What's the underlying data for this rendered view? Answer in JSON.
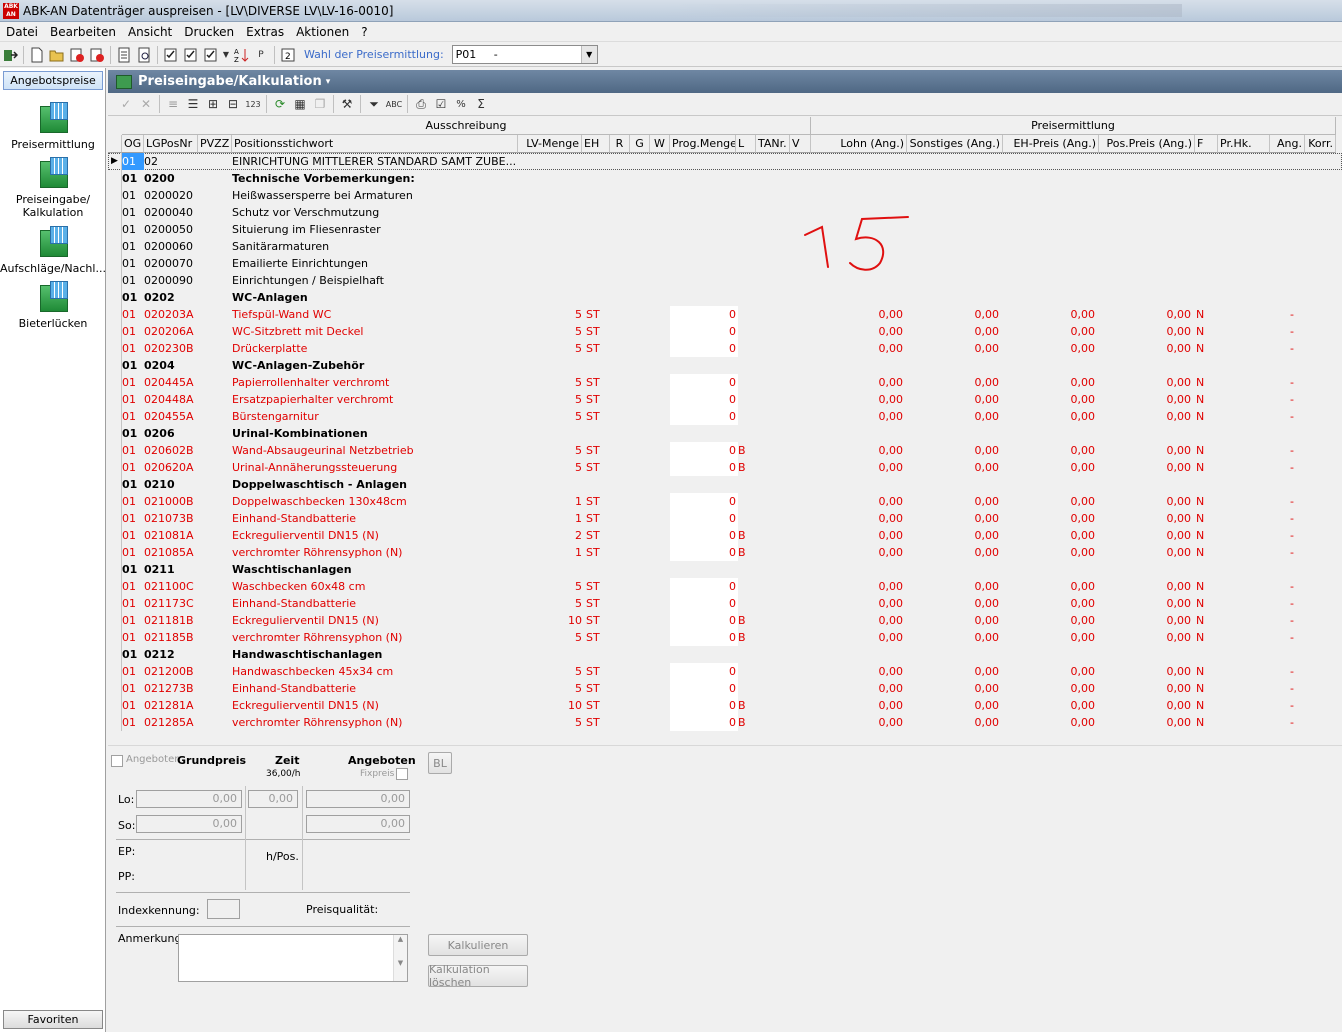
{
  "window": {
    "title": "ABK-AN Datenträger auspreisen - [LV\\DIVERSE LV\\LV-16-0010]",
    "app_icon_text": "ABK AN"
  },
  "menu": [
    "Datei",
    "Bearbeiten",
    "Ansicht",
    "Drucken",
    "Extras",
    "Aktionen",
    "?"
  ],
  "toolbar": {
    "preis_label": "Wahl der Preisermittlung:",
    "preis_value": "P01     -"
  },
  "sidebar": {
    "top_button": "Angebotspreise",
    "items": [
      "Preisermittlung",
      "Preiseingabe/\nKalkulation",
      "Aufschläge/Nachl...",
      "Bieterlücken"
    ],
    "favorites": "Favoriten"
  },
  "panel": {
    "title": "Preiseingabe/Kalkulation"
  },
  "grid": {
    "group_headers": [
      "Ausschreibung",
      "Preisermittlung"
    ],
    "columns": [
      "OG",
      "LGPosNr",
      "PVZZ",
      "Positionsstichwort",
      "LV-Menge",
      "EH",
      "R",
      "G",
      "W",
      "Prog.Menge",
      "L",
      "TANr.",
      "V",
      "Lohn (Ang.)",
      "Sonstiges (Ang.)",
      "EH-Preis  (Ang.)",
      "Pos.Preis (Ang.)",
      "F",
      "Pr.Hk.",
      "Ang.",
      "Korr."
    ],
    "rows": [
      {
        "type": "sel",
        "og": "01",
        "pos": "02",
        "text": "EINRICHTUNG MITTLERER STANDARD SAMT ZUBE..."
      },
      {
        "type": "bold",
        "og": "01",
        "pos": "0200",
        "text": "Technische Vorbemerkungen:"
      },
      {
        "type": "plain",
        "og": "01",
        "pos": "0200020",
        "text": "Heißwassersperre bei Armaturen"
      },
      {
        "type": "plain",
        "og": "01",
        "pos": "0200040",
        "text": "Schutz vor Verschmutzung"
      },
      {
        "type": "plain",
        "og": "01",
        "pos": "0200050",
        "text": "Situierung im Fliesenraster"
      },
      {
        "type": "plain",
        "og": "01",
        "pos": "0200060",
        "text": "Sanitärarmaturen"
      },
      {
        "type": "plain",
        "og": "01",
        "pos": "0200070",
        "text": "Emailierte Einrichtungen"
      },
      {
        "type": "plain",
        "og": "01",
        "pos": "0200090",
        "text": "Einrichtungen / Beispielhaft"
      },
      {
        "type": "bold",
        "og": "01",
        "pos": "0202",
        "text": "WC-Anlagen"
      },
      {
        "type": "red",
        "og": "01",
        "pos": "020203A",
        "text": "Tiefspül-Wand WC",
        "menge": "5",
        "eh": "ST",
        "prog": "0",
        "l": "",
        "lohn": "0,00",
        "sonst": "0,00",
        "ehp": "0,00",
        "posp": "0,00",
        "f": "N",
        "ang": "-"
      },
      {
        "type": "red",
        "og": "01",
        "pos": "020206A",
        "text": "WC-Sitzbrett mit Deckel",
        "menge": "5",
        "eh": "ST",
        "prog": "0",
        "l": "",
        "lohn": "0,00",
        "sonst": "0,00",
        "ehp": "0,00",
        "posp": "0,00",
        "f": "N",
        "ang": "-"
      },
      {
        "type": "red",
        "og": "01",
        "pos": "020230B",
        "text": "Drückerplatte",
        "menge": "5",
        "eh": "ST",
        "prog": "0",
        "l": "",
        "lohn": "0,00",
        "sonst": "0,00",
        "ehp": "0,00",
        "posp": "0,00",
        "f": "N",
        "ang": "-"
      },
      {
        "type": "bold",
        "og": "01",
        "pos": "0204",
        "text": "WC-Anlagen-Zubehör"
      },
      {
        "type": "red",
        "og": "01",
        "pos": "020445A",
        "text": "Papierrollenhalter verchromt",
        "menge": "5",
        "eh": "ST",
        "prog": "0",
        "l": "",
        "lohn": "0,00",
        "sonst": "0,00",
        "ehp": "0,00",
        "posp": "0,00",
        "f": "N",
        "ang": "-"
      },
      {
        "type": "red",
        "og": "01",
        "pos": "020448A",
        "text": "Ersatzpapierhalter verchromt",
        "menge": "5",
        "eh": "ST",
        "prog": "0",
        "l": "",
        "lohn": "0,00",
        "sonst": "0,00",
        "ehp": "0,00",
        "posp": "0,00",
        "f": "N",
        "ang": "-"
      },
      {
        "type": "red",
        "og": "01",
        "pos": "020455A",
        "text": "Bürstengarnitur",
        "menge": "5",
        "eh": "ST",
        "prog": "0",
        "l": "",
        "lohn": "0,00",
        "sonst": "0,00",
        "ehp": "0,00",
        "posp": "0,00",
        "f": "N",
        "ang": "-"
      },
      {
        "type": "bold",
        "og": "01",
        "pos": "0206",
        "text": "Urinal-Kombinationen"
      },
      {
        "type": "red",
        "og": "01",
        "pos": "020602B",
        "text": "Wand-Absaugeurinal Netzbetrieb",
        "menge": "5",
        "eh": "ST",
        "prog": "0",
        "l": "B",
        "lohn": "0,00",
        "sonst": "0,00",
        "ehp": "0,00",
        "posp": "0,00",
        "f": "N",
        "ang": "-"
      },
      {
        "type": "red",
        "og": "01",
        "pos": "020620A",
        "text": "Urinal-Annäherungssteuerung",
        "menge": "5",
        "eh": "ST",
        "prog": "0",
        "l": "B",
        "lohn": "0,00",
        "sonst": "0,00",
        "ehp": "0,00",
        "posp": "0,00",
        "f": "N",
        "ang": "-"
      },
      {
        "type": "bold",
        "og": "01",
        "pos": "0210",
        "text": "Doppelwaschtisch - Anlagen"
      },
      {
        "type": "red",
        "og": "01",
        "pos": "021000B",
        "text": "Doppelwaschbecken 130x48cm",
        "menge": "1",
        "eh": "ST",
        "prog": "0",
        "l": "",
        "lohn": "0,00",
        "sonst": "0,00",
        "ehp": "0,00",
        "posp": "0,00",
        "f": "N",
        "ang": "-"
      },
      {
        "type": "red",
        "og": "01",
        "pos": "021073B",
        "text": "Einhand-Standbatterie",
        "menge": "1",
        "eh": "ST",
        "prog": "0",
        "l": "",
        "lohn": "0,00",
        "sonst": "0,00",
        "ehp": "0,00",
        "posp": "0,00",
        "f": "N",
        "ang": "-"
      },
      {
        "type": "red",
        "og": "01",
        "pos": "021081A",
        "text": "Eckregulierventil DN15 (N)",
        "menge": "2",
        "eh": "ST",
        "prog": "0",
        "l": "B",
        "lohn": "0,00",
        "sonst": "0,00",
        "ehp": "0,00",
        "posp": "0,00",
        "f": "N",
        "ang": "-"
      },
      {
        "type": "red",
        "og": "01",
        "pos": "021085A",
        "text": "verchromter Röhrensyphon (N)",
        "menge": "1",
        "eh": "ST",
        "prog": "0",
        "l": "B",
        "lohn": "0,00",
        "sonst": "0,00",
        "ehp": "0,00",
        "posp": "0,00",
        "f": "N",
        "ang": "-"
      },
      {
        "type": "bold",
        "og": "01",
        "pos": "0211",
        "text": "Waschtischanlagen"
      },
      {
        "type": "red",
        "og": "01",
        "pos": "021100C",
        "text": "Waschbecken 60x48 cm",
        "menge": "5",
        "eh": "ST",
        "prog": "0",
        "l": "",
        "lohn": "0,00",
        "sonst": "0,00",
        "ehp": "0,00",
        "posp": "0,00",
        "f": "N",
        "ang": "-"
      },
      {
        "type": "red",
        "og": "01",
        "pos": "021173C",
        "text": "Einhand-Standbatterie",
        "menge": "5",
        "eh": "ST",
        "prog": "0",
        "l": "",
        "lohn": "0,00",
        "sonst": "0,00",
        "ehp": "0,00",
        "posp": "0,00",
        "f": "N",
        "ang": "-"
      },
      {
        "type": "red",
        "og": "01",
        "pos": "021181B",
        "text": "Eckregulierventil DN15 (N)",
        "menge": "10",
        "eh": "ST",
        "prog": "0",
        "l": "B",
        "lohn": "0,00",
        "sonst": "0,00",
        "ehp": "0,00",
        "posp": "0,00",
        "f": "N",
        "ang": "-"
      },
      {
        "type": "red",
        "og": "01",
        "pos": "021185B",
        "text": "verchromter Röhrensyphon (N)",
        "menge": "5",
        "eh": "ST",
        "prog": "0",
        "l": "B",
        "lohn": "0,00",
        "sonst": "0,00",
        "ehp": "0,00",
        "posp": "0,00",
        "f": "N",
        "ang": "-"
      },
      {
        "type": "bold",
        "og": "01",
        "pos": "0212",
        "text": "Handwaschtischanlagen"
      },
      {
        "type": "red",
        "og": "01",
        "pos": "021200B",
        "text": "Handwaschbecken 45x34 cm",
        "menge": "5",
        "eh": "ST",
        "prog": "0",
        "l": "",
        "lohn": "0,00",
        "sonst": "0,00",
        "ehp": "0,00",
        "posp": "0,00",
        "f": "N",
        "ang": "-"
      },
      {
        "type": "red",
        "og": "01",
        "pos": "021273B",
        "text": "Einhand-Standbatterie",
        "menge": "5",
        "eh": "ST",
        "prog": "0",
        "l": "",
        "lohn": "0,00",
        "sonst": "0,00",
        "ehp": "0,00",
        "posp": "0,00",
        "f": "N",
        "ang": "-"
      },
      {
        "type": "red",
        "og": "01",
        "pos": "021281A",
        "text": "Eckregulierventil DN15 (N)",
        "menge": "10",
        "eh": "ST",
        "prog": "0",
        "l": "B",
        "lohn": "0,00",
        "sonst": "0,00",
        "ehp": "0,00",
        "posp": "0,00",
        "f": "N",
        "ang": "-"
      },
      {
        "type": "red",
        "og": "01",
        "pos": "021285A",
        "text": "verchromter Röhrensyphon (N)",
        "menge": "5",
        "eh": "ST",
        "prog": "0",
        "l": "B",
        "lohn": "0,00",
        "sonst": "0,00",
        "ehp": "0,00",
        "posp": "0,00",
        "f": "N",
        "ang": "-"
      }
    ]
  },
  "details": {
    "angeboten_chk": "Angeboten",
    "grundpreis": "Grundpreis",
    "zeit": "Zeit",
    "zeit_rate": "36,00/h",
    "angeboten": "Angeboten",
    "fixpreis": "Fixpreis",
    "bl": "BL",
    "lo": "Lo:",
    "so": "So:",
    "ep": "EP:",
    "pp": "PP:",
    "hpos": "h/Pos.",
    "zero": "0,00",
    "indexkennung": "Indexkennung:",
    "preisqualitaet": "Preisqualität:",
    "anmerkung": "Anmerkung:",
    "kalkulieren": "Kalkulieren",
    "kalk_loeschen": "Kalkulation löschen"
  },
  "colors": {
    "red_text": "#e00000",
    "header_blue": "#4f6884",
    "select_blue": "#3399ff",
    "annotation_red": "#e01010"
  }
}
